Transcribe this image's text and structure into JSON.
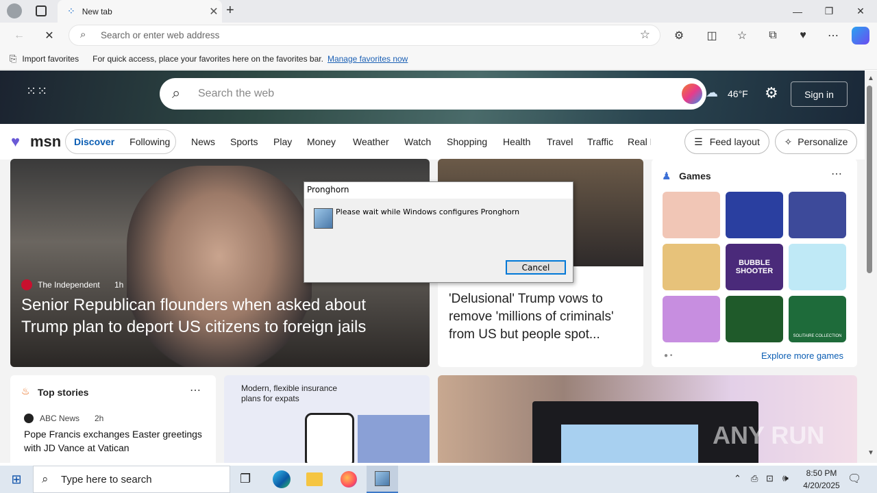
{
  "browser": {
    "tab_title": "New tab",
    "address_placeholder": "Search or enter web address",
    "favbar_import": "Import favorites",
    "favbar_text": "For quick access, place your favorites here on the favorites bar.",
    "favbar_link": "Manage favorites now"
  },
  "msn": {
    "search_placeholder": "Search the web",
    "temperature": "46°F",
    "signin": "Sign in",
    "logo": "msn",
    "tabs": [
      "Discover",
      "Following"
    ],
    "nav": [
      "News",
      "Sports",
      "Play",
      "Money",
      "Weather",
      "Watch",
      "Shopping",
      "Health",
      "Travel",
      "Traffic",
      "Real E"
    ],
    "feed_layout": "Feed layout",
    "personalize": "Personalize",
    "hero_source": "The Independent",
    "hero_time": "1h",
    "hero_headline": "Senior Republican flounders when asked about Trump plan to deport US citizens to foreign jails",
    "second_headline": "'Delusional' Trump vows to remove 'millions of criminals' from US but people spot...",
    "games_title": "Games",
    "games_more": "Explore more games",
    "game_labels": {
      "bubble": "BUBBLE SHOOTER",
      "solitaire": "SOLITAIRE COLLECTION"
    },
    "top_stories": "Top stories",
    "ts_source": "ABC News",
    "ts_time": "2h",
    "ts_headline": "Pope Francis exchanges Easter greetings with JD Vance at Vatican",
    "ad_text": "Modern, flexible insurance plans for expats"
  },
  "dialog": {
    "title": "Pronghorn",
    "message": "Please wait while Windows configures Pronghorn",
    "cancel": "Cancel"
  },
  "taskbar": {
    "search_placeholder": "Type here to search",
    "time": "8:50 PM",
    "date": "4/20/2025"
  },
  "watermark": "ANY RUN"
}
